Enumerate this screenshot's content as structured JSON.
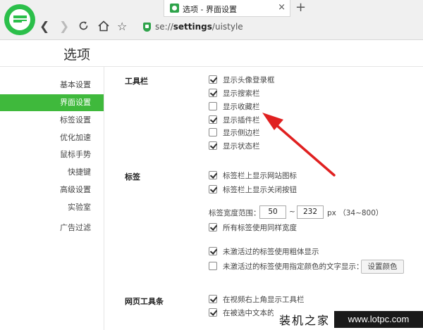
{
  "browser": {
    "tab_title": "选项 - 界面设置",
    "tab_close": "×",
    "new_tab": "+",
    "address_prefix": "se://",
    "address_bold": "settings",
    "address_suffix": "/uistyle",
    "nav_icons": [
      "back-icon",
      "forward-icon",
      "refresh-icon",
      "home-icon",
      "star-icon"
    ],
    "accent": "#3fb93c"
  },
  "page": {
    "title": "选项"
  },
  "sidebar": {
    "items": [
      {
        "label": "基本设置"
      },
      {
        "label": "界面设置",
        "active": true
      },
      {
        "label": "标签设置"
      },
      {
        "label": "优化加速"
      },
      {
        "label": "鼠标手势"
      },
      {
        "label": "快捷键"
      },
      {
        "label": "高级设置"
      },
      {
        "label": "实验室"
      },
      {
        "label": "广告过滤"
      }
    ]
  },
  "toolbar_section": {
    "label": "工具栏",
    "options": [
      {
        "label": "显示头像登录框",
        "checked": true
      },
      {
        "label": "显示搜索栏",
        "checked": true
      },
      {
        "label": "显示收藏栏",
        "checked": false
      },
      {
        "label": "显示插件栏",
        "checked": true
      },
      {
        "label": "显示侧边栏",
        "checked": false
      },
      {
        "label": "显示状态栏",
        "checked": true
      }
    ]
  },
  "tabs_section": {
    "label": "标签",
    "options": [
      {
        "label": "标签栏上显示网站图标",
        "checked": true
      },
      {
        "label": "标签栏上显示关闭按钮",
        "checked": true
      }
    ],
    "width_range": {
      "label": "标签宽度范围：",
      "min": "50",
      "separator": "~",
      "max": "232",
      "unit": "px （34~800）"
    },
    "same_width": {
      "label": "所有标签使用同样宽度",
      "checked": true
    },
    "inactive_bold": {
      "label": "未激活过的标签使用粗体显示",
      "checked": true
    },
    "inactive_color": {
      "label": "未激活过的标签使用指定颜色的文字显示：",
      "checked": false
    },
    "set_color_button": "设置颜色"
  },
  "webtoolbar_section": {
    "label": "网页工具条",
    "options": [
      {
        "label": "在视频右上角显示工具栏",
        "checked": true
      },
      {
        "label": "在被选中文本的",
        "checked": true
      }
    ]
  },
  "annotation": {
    "arrow_color": "#e02020"
  },
  "watermark": {
    "text": "装机之家",
    "url": "www.lotpc.com"
  }
}
